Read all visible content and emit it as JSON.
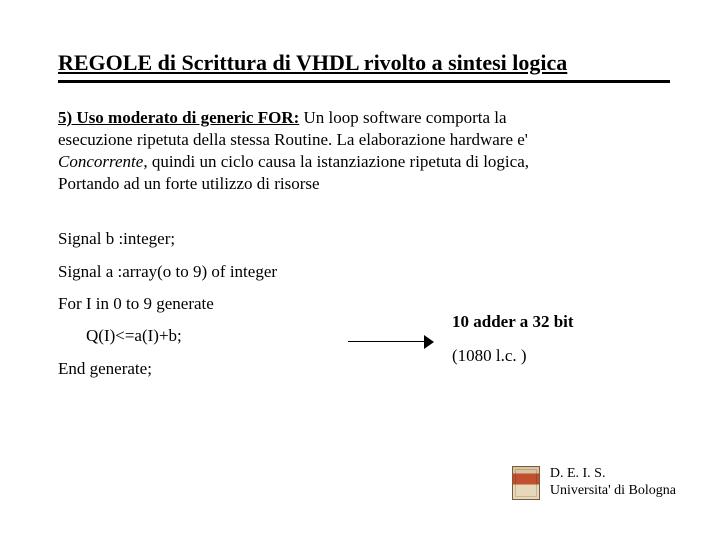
{
  "title": "REGOLE di Scrittura di VHDL rivolto a sintesi logica",
  "para": {
    "lead_bold": "5) Uso moderato di generic FOR:",
    "rest1": " Un loop software comporta la",
    "line2": "esecuzione ripetuta della stessa Routine. La elaborazione hardware e'",
    "concorrente": "Concorrente",
    "rest3": ", quindi un ciclo causa la istanziazione ripetuta di logica,",
    "line4": "Portando ad un forte utilizzo di risorse"
  },
  "code": {
    "c1": "Signal b :integer;",
    "c2": "Signal a :array(o to 9) of integer",
    "c3": "For I in 0 to 9 generate",
    "c4": "Q(I)<=a(I)+b;",
    "c5": "End generate;"
  },
  "right": {
    "adders": "10 adder a 32 bit",
    "cells": "(1080 l.c. )"
  },
  "footer": {
    "line1": "D. E. I. S.",
    "line2": "Universita' di Bologna"
  }
}
